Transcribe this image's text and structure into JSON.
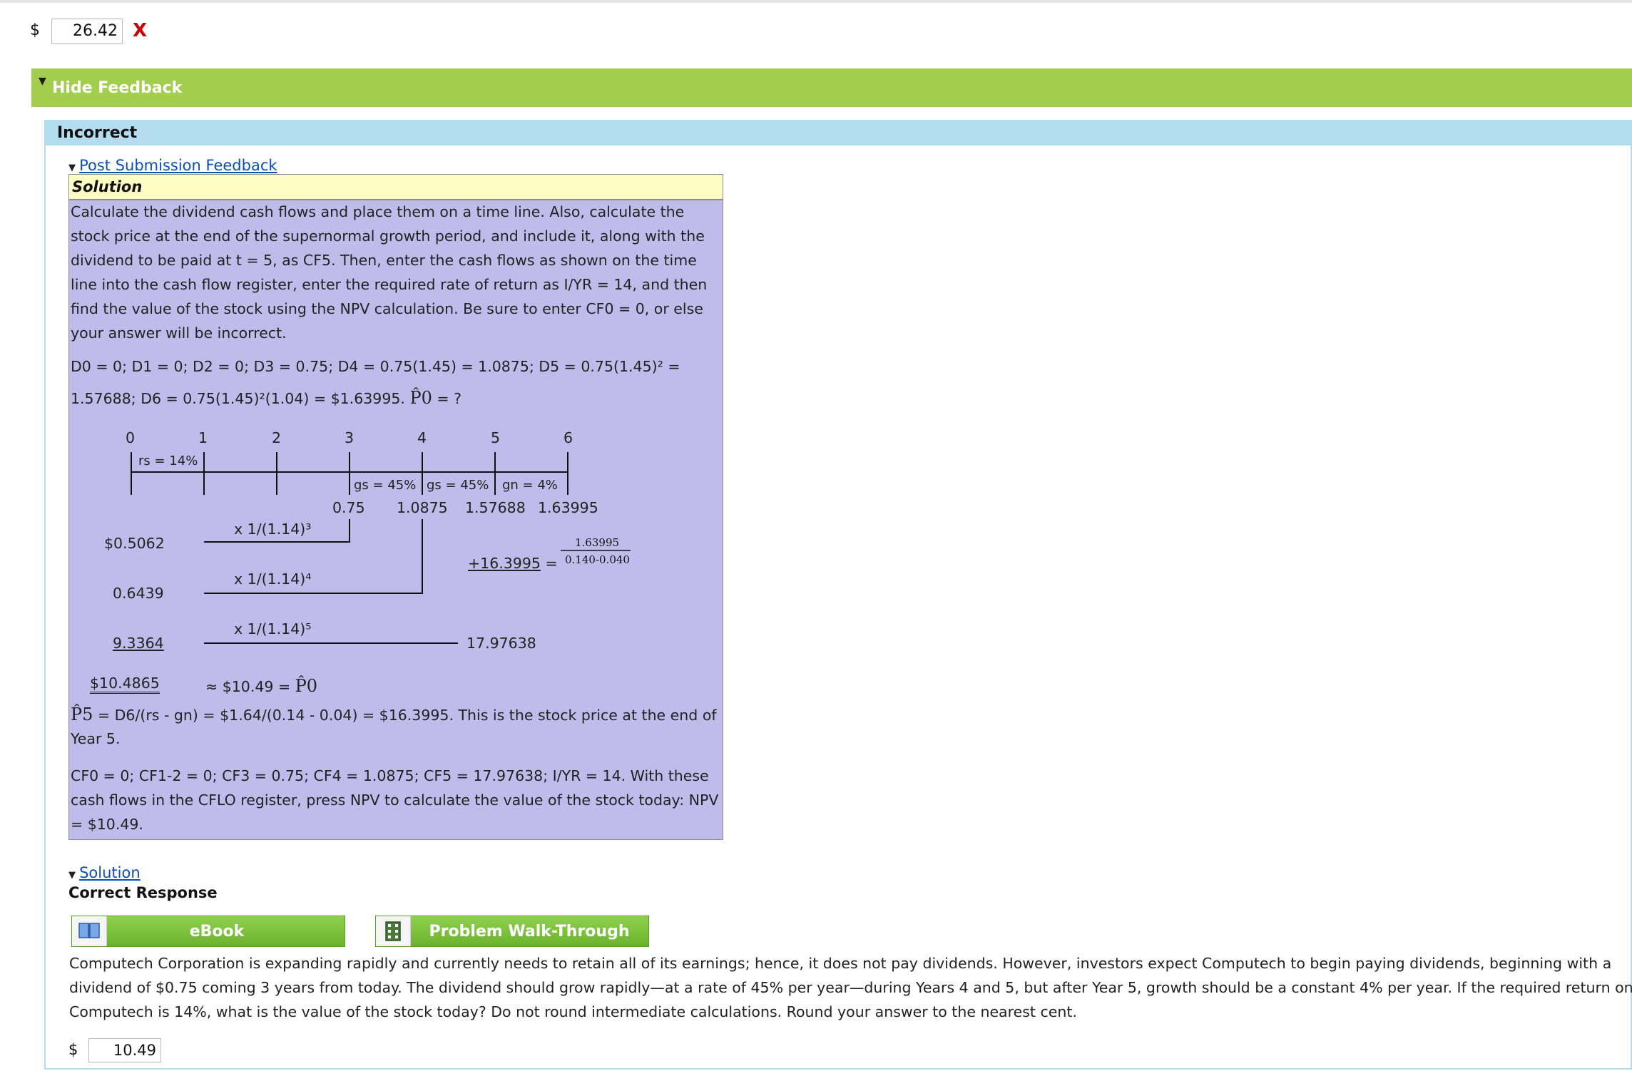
{
  "top_answer": {
    "currency": "$",
    "value": "26.42",
    "mark": "X"
  },
  "feedback_toggle": {
    "label": "Hide Feedback"
  },
  "result": {
    "label": "Incorrect"
  },
  "post_feedback": {
    "link": "Post Submission Feedback"
  },
  "solution": {
    "heading": "Solution",
    "para1": "Calculate the dividend cash flows and place them on a time line. Also, calculate the stock price at the end of the supernormal growth period, and include it, along with the dividend to be paid at t = 5, as CF5. Then, enter the cash flows as shown on the time line into the cash flow register, enter the required rate of return as I/YR = 14, and then find the value of the stock using the NPV calculation. Be sure to enter CF0 = 0, or else your answer will be incorrect.",
    "divs_line1": "D0 = 0; D1 = 0; D2 = 0; D3 = 0.75; D4 = 0.75(1.45) = 1.0875; D5 = 0.75(1.45)² =",
    "divs_line2_a": "1.57688; D6 = 0.75(1.45)²(1.04) = $1.63995.",
    "divs_line2_p0": "P̂0",
    "divs_line2_b": "= ?",
    "timeline": {
      "periods": [
        "0",
        "1",
        "2",
        "3",
        "4",
        "5",
        "6"
      ],
      "rate_rs": "rs = 14%",
      "growth": [
        "gs = 45%",
        "gs = 45%",
        "gn = 4%"
      ],
      "cashflows": [
        "0.75",
        "1.0875",
        "1.57688",
        "1.63995"
      ],
      "pv_labels": [
        "$0.5062",
        "0.6439",
        "9.3364"
      ],
      "discount_factors": [
        "x 1/(1.14)³",
        "x 1/(1.14)⁴",
        "x 1/(1.14)⁵"
      ],
      "terminal_value": "+16.3995",
      "equals": "=",
      "fraction_num": "1.63995",
      "fraction_den": "0.140-0.040",
      "cf5_total": "17.97638",
      "sum": "$10.4865",
      "approx": "≈ $10.49 =",
      "p0": "P̂0"
    },
    "p5_line1_sym": "P̂5",
    "p5_line1": "= D6/(rs - gn) = $1.64/(0.14 - 0.04) = $16.3995. This is the stock price at the end of",
    "p5_line2": "Year 5.",
    "cf_line1": "CF0 = 0; CF1-2 = 0; CF3 = 0.75; CF4 = 1.0875; CF5 = 17.97638; I/YR = 14. With these",
    "cf_line2": "cash flows in the CFLO register, press NPV to calculate the value of the stock today: NPV",
    "cf_line3": "= $10.49."
  },
  "solution_link": {
    "label": "Solution"
  },
  "correct_response": {
    "label": "Correct Response"
  },
  "buttons": {
    "ebook": "eBook",
    "walkthrough": "Problem Walk-Through"
  },
  "question": {
    "line1": "Computech Corporation is expanding rapidly and currently needs to retain all of its earnings; hence, it does not pay dividends. However, investors expect Computech to begin paying dividends, beginning with a",
    "line2": "dividend of $0.75 coming 3 years from today. The dividend should grow rapidly—at a rate of 45% per year—during Years 4 and 5, but after Year 5, growth should be a constant 4% per year. If the required return on",
    "line3": "Computech is 14%, what is the value of the stock today? Do not round intermediate calculations. Round your answer to the nearest cent."
  },
  "correct_answer": {
    "currency": "$",
    "value": "10.49"
  }
}
